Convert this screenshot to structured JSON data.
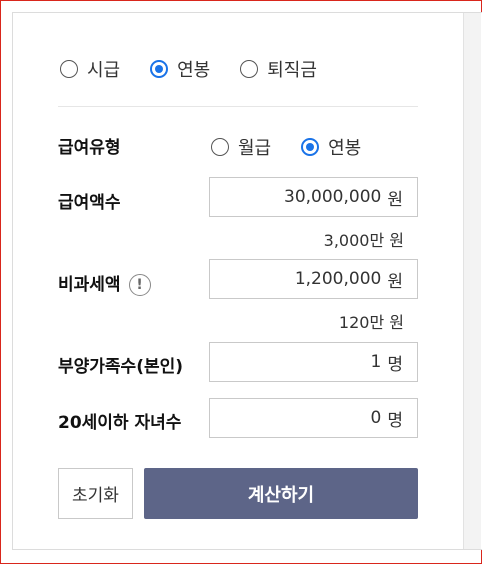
{
  "mode_options": [
    {
      "label": "시급",
      "checked": false
    },
    {
      "label": "연봉",
      "checked": true
    },
    {
      "label": "퇴직금",
      "checked": false
    }
  ],
  "salary_type": {
    "label": "급여유형",
    "options": [
      {
        "label": "월급",
        "checked": false
      },
      {
        "label": "연봉",
        "checked": true
      }
    ]
  },
  "salary_amount": {
    "label": "급여액수",
    "value": "30,000,000",
    "unit": "원",
    "sub": "3,000만 원"
  },
  "nontaxable": {
    "label": "비과세액",
    "info_icon": "!",
    "value": "1,200,000",
    "unit": "원",
    "sub": "120만 원"
  },
  "dependents": {
    "label": "부양가족수(본인)",
    "value": "1",
    "unit": "명"
  },
  "children": {
    "label": "20세이하 자녀수",
    "value": "0",
    "unit": "명"
  },
  "buttons": {
    "reset": "초기화",
    "calculate": "계산하기"
  },
  "colors": {
    "accent": "#1a73e8",
    "calc_button": "#5d6588",
    "frame": "#d9261c"
  }
}
